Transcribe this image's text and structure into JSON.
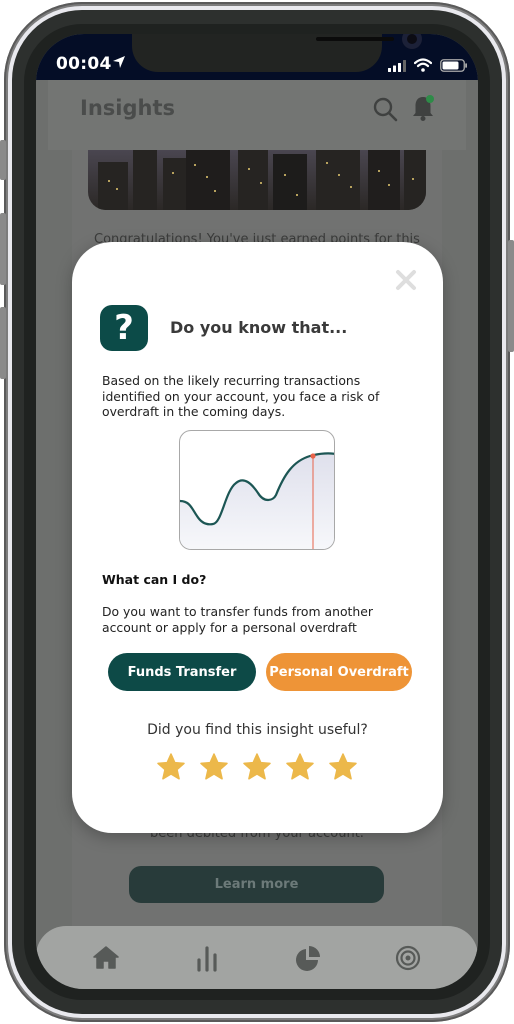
{
  "status_bar": {
    "time": "00:04"
  },
  "header": {
    "title": "Insights",
    "icons": [
      "search-icon",
      "bell-icon"
    ],
    "notification_dot_color": "#2e8b48"
  },
  "background_card": {
    "text_top": "Congratulations! You've just earned points for this",
    "text_bottom": "been debited from your account.",
    "learn_more_label": "Learn more"
  },
  "modal": {
    "title": "Do you know that...",
    "badge_symbol": "?",
    "description": "Based on the likely recurring transactions identified on your account, you face a risk of overdraft in the coming days.",
    "section_title": "What can I do?",
    "section_description": "Do you want to transfer funds from another account or apply for a personal overdraft",
    "buttons": {
      "funds_transfer": "Funds Transfer",
      "personal_overdraft": "Personal Overdraft"
    },
    "feedback_question": "Did you find this insight useful?",
    "rating": {
      "filled": 5,
      "max": 5
    },
    "colors": {
      "primary": "#0d4a47",
      "accent": "#ee9437",
      "star": "#ecb84a",
      "marker": "#e8634a"
    }
  },
  "tabbar": {
    "items": [
      "home-icon",
      "bar-chart-icon",
      "pie-chart-icon",
      "target-icon"
    ]
  }
}
